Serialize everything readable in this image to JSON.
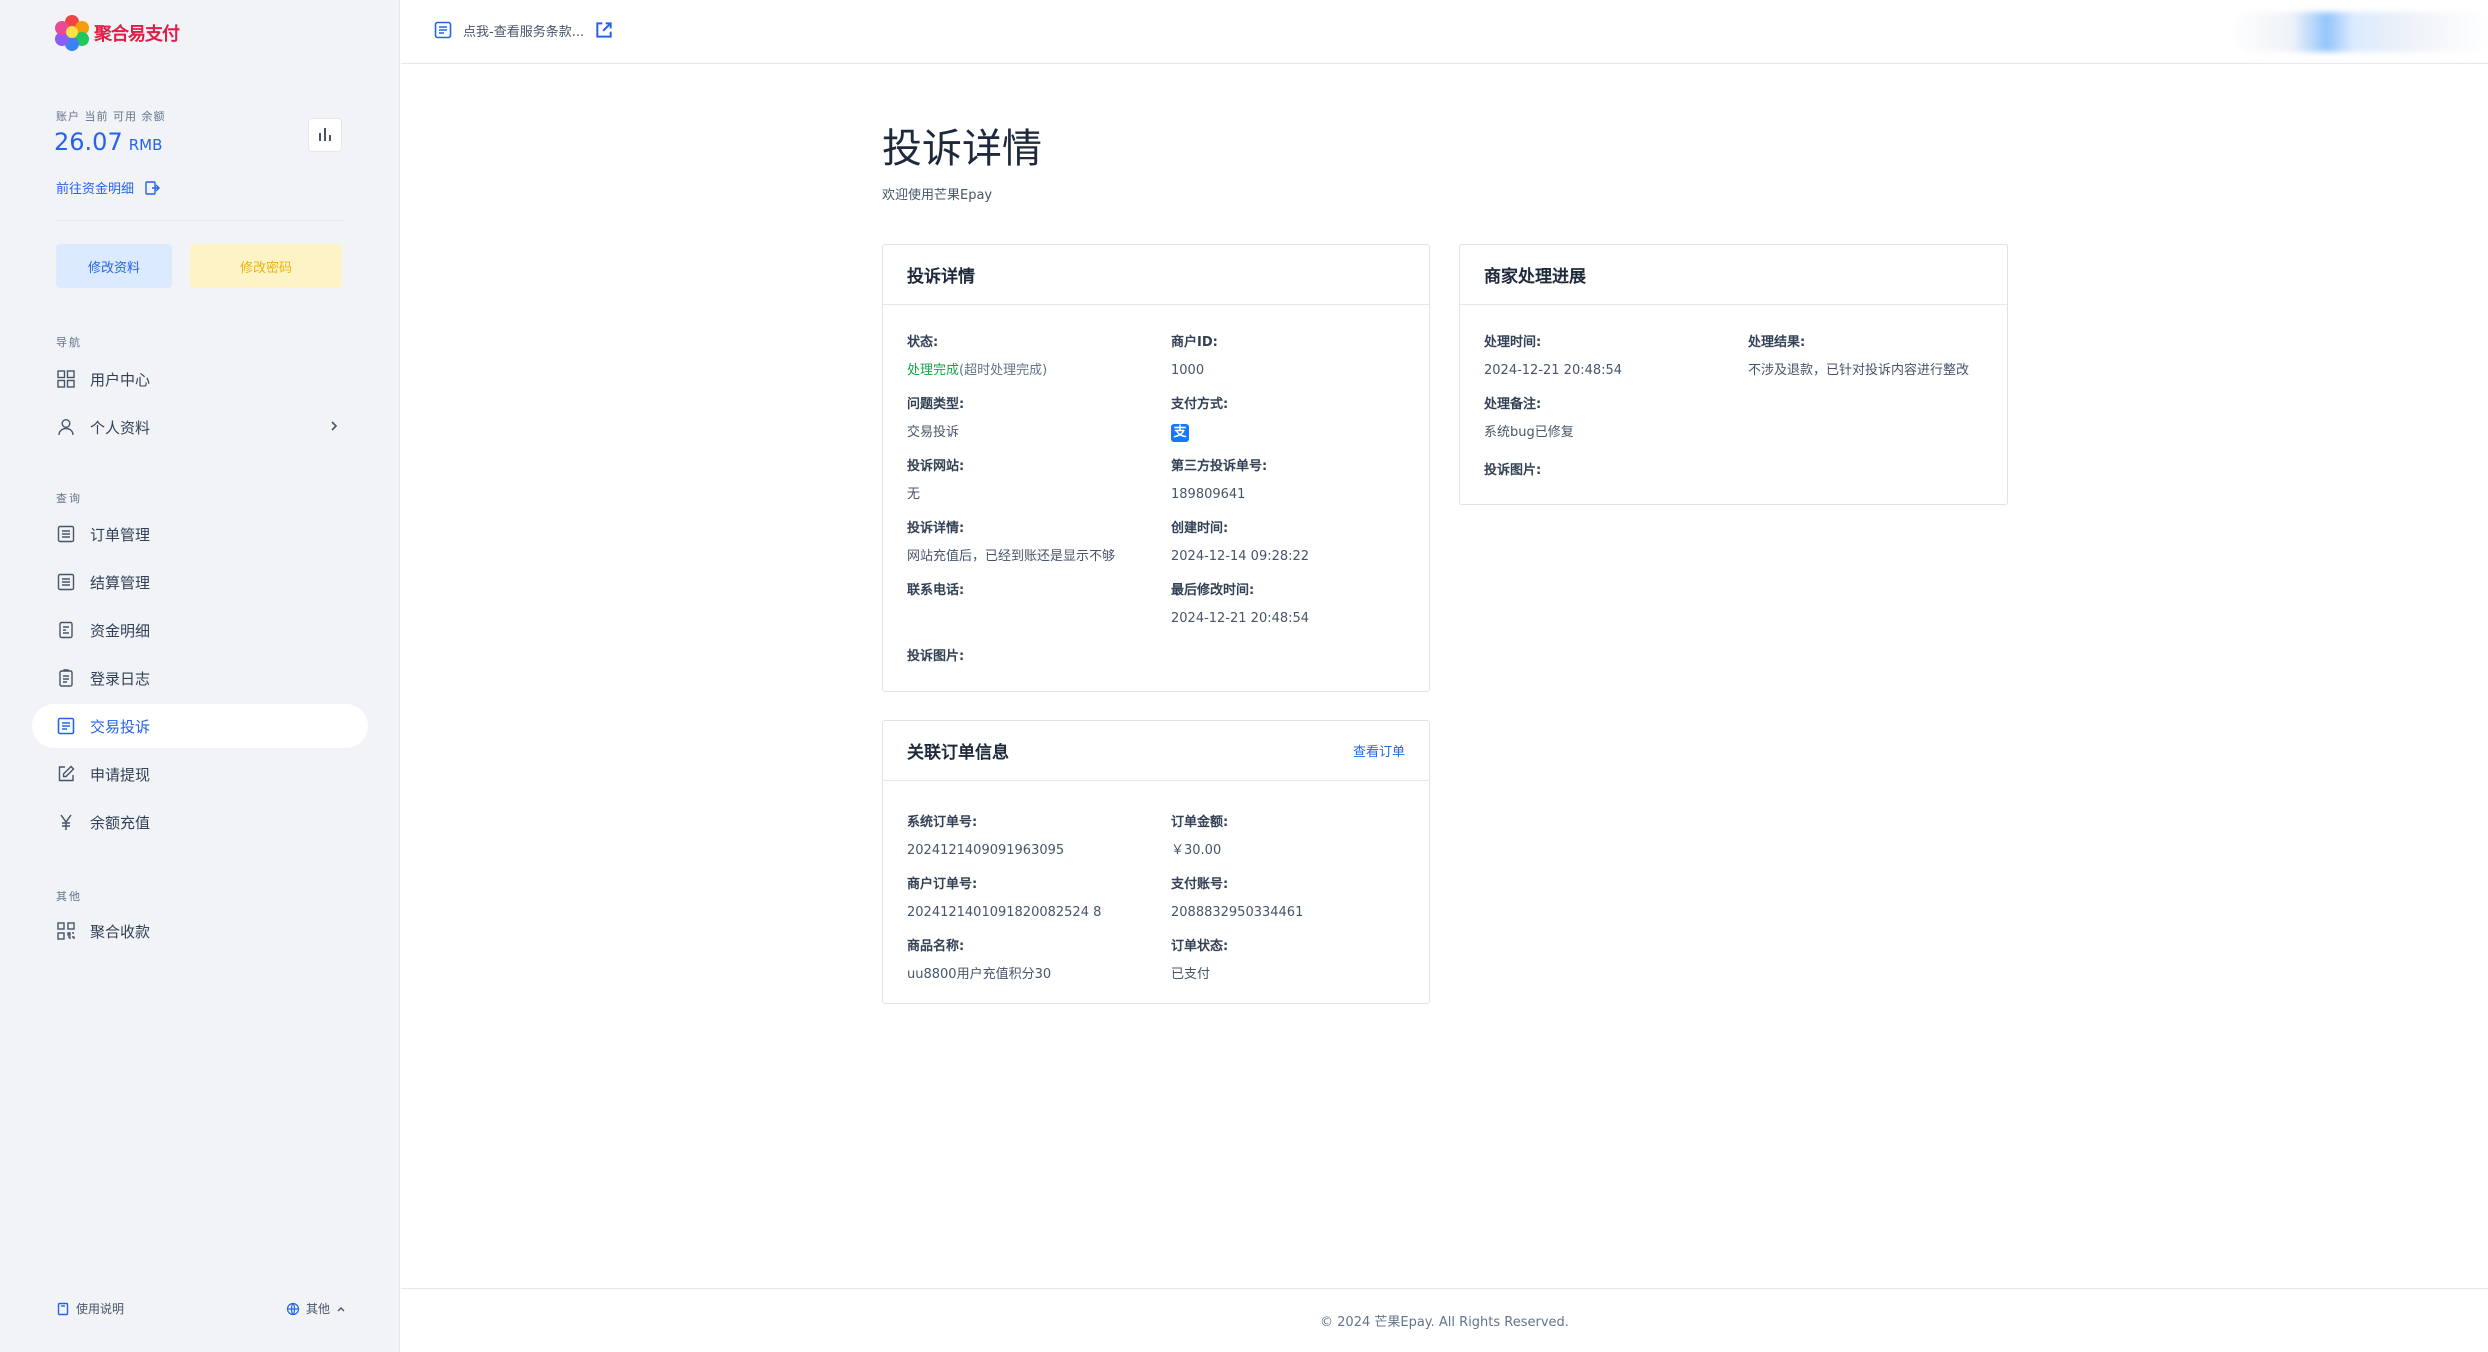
{
  "brand": {
    "name": "聚合易支付"
  },
  "account": {
    "balance_label": "账户 当前 可用 余额",
    "balance": "26.07",
    "currency": "RMB",
    "fund_link": "前往资金明细",
    "edit_profile": "修改资料",
    "edit_password": "修改密码"
  },
  "nav": {
    "section_nav": "导航",
    "user_center": "用户中心",
    "profile": "个人资料",
    "section_query": "查询",
    "orders": "订单管理",
    "settlement": "结算管理",
    "funds": "资金明细",
    "login_log": "登录日志",
    "complaints": "交易投诉",
    "withdraw": "申请提现",
    "recharge": "余额充值",
    "section_other": "其他",
    "aggregate": "聚合收款"
  },
  "sidebar_footer": {
    "help": "使用说明",
    "other": "其他"
  },
  "header": {
    "notice": "点我-查看服务条款..."
  },
  "page": {
    "title": "投诉详情",
    "subtitle": "欢迎使用芒果Epay"
  },
  "complaint": {
    "title": "投诉详情",
    "status_label": "状态:",
    "status_value": "处理完成",
    "status_note": "(超时处理完成)",
    "merchant_label": "商户ID:",
    "merchant_value": "1000",
    "issue_label": "问题类型:",
    "issue_value": "交易投诉",
    "paymethod_label": "支付方式:",
    "paymethod_icon": "支",
    "site_label": "投诉网站:",
    "site_value": "无",
    "third_label": "第三方投诉单号:",
    "third_value": "189809641",
    "detail_label": "投诉详情:",
    "detail_value": "网站充值后，已经到账还是显示不够",
    "created_label": "创建时间:",
    "created_value": "2024-12-14 09:28:22",
    "phone_label": "联系电话:",
    "modified_label": "最后修改时间:",
    "modified_value": "2024-12-21 20:48:54",
    "images_label": "投诉图片:"
  },
  "progress": {
    "title": "商家处理进展",
    "time_label": "处理时间:",
    "time_value": "2024-12-21 20:48:54",
    "result_label": "处理结果:",
    "result_value": "不涉及退款，已针对投诉内容进行整改",
    "note_label": "处理备注:",
    "note_value": "系统bug已修复",
    "images_label": "投诉图片:"
  },
  "order": {
    "title": "关联订单信息",
    "view_link": "查看订单",
    "sys_label": "系统订单号:",
    "sys_value": "2024121409091963095",
    "amount_label": "订单金额:",
    "amount_value": "￥30.00",
    "merchant_order_label": "商户订单号:",
    "merchant_order_value": "2024121401091820082524 8",
    "account_label": "支付账号:",
    "account_value": "2088832950334461",
    "product_label": "商品名称:",
    "product_value": "uu8800用户充值积分30",
    "status_label": "订单状态:",
    "status_value": "已支付"
  },
  "footer": {
    "copyright": "© 2024 芒果Epay. All Rights Reserved."
  },
  "colors": {
    "accent": "#2563eb",
    "success": "#16a34a",
    "warning": "#eab308",
    "brand": "#e11d48"
  }
}
